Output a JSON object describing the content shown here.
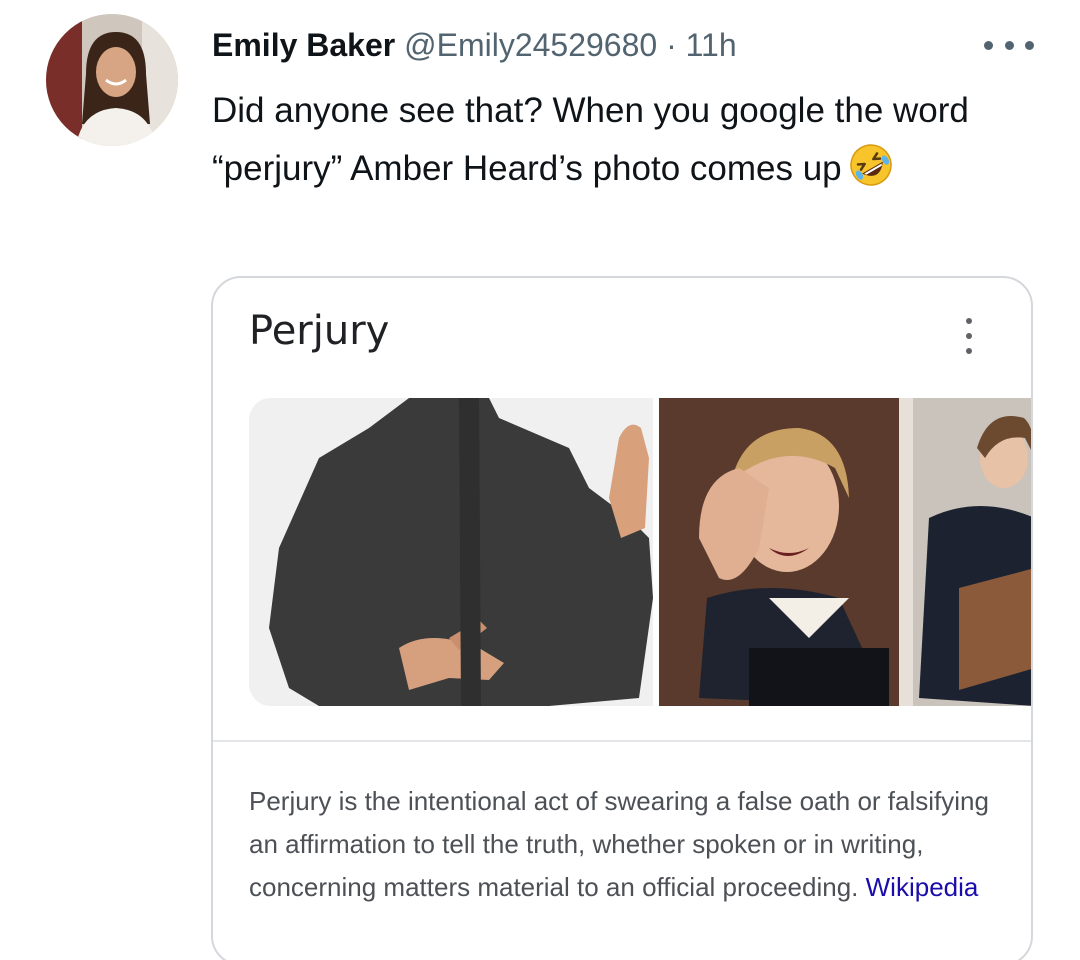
{
  "tweet": {
    "author_name": "Emily Baker",
    "handle": "@Emily24529680",
    "separator": "·",
    "time": "11h",
    "text": "Did anyone see that? When you google the word “perjury” Amber Heard’s photo comes up",
    "emoji": "rolling-on-floor-laughing"
  },
  "card": {
    "title": "Perjury",
    "description": "Perjury is the intentional act of swearing a false oath or falsifying an affirmation to tell the truth, whether spoken or in writing, concerning matters material to an official proceeding.",
    "source_link": "Wikipedia"
  },
  "icons": {
    "more": "more-horizontal-icon",
    "card_menu": "more-vertical-icon"
  },
  "colors": {
    "name": "#0f1419",
    "secondary_text": "#536471",
    "card_border": "#d4d8dc",
    "link": "#1a0dab",
    "description_text": "#4d5156"
  }
}
